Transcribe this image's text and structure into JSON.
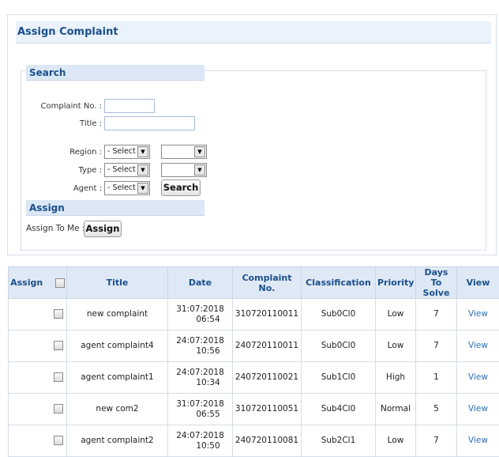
{
  "panel": {
    "title": "Assign Complaint"
  },
  "search": {
    "section_title": "Search",
    "complaint_no_label": "Complaint No. :",
    "complaint_no_value": "",
    "title_label": "Title :",
    "title_value": "",
    "region_label": "Region :",
    "region_selected": "- Select -",
    "region_sub_selected": "",
    "type_label": "Type :",
    "type_selected": "- Select -",
    "type_sub_selected": "",
    "agent_label": "Agent :",
    "agent_selected": "- Select -",
    "search_button": "Search"
  },
  "assign": {
    "section_title": "Assign",
    "assign_to_me_label": "Assign To Me :",
    "assign_button": "Assign"
  },
  "table": {
    "headers": [
      "Assign",
      "Title",
      "Date",
      "Complaint No.",
      "Classification",
      "Priority",
      "Days To Solve",
      "View"
    ],
    "rows": [
      {
        "title": "new complaint",
        "date": "31:07:2018",
        "time": "06:54",
        "complaint_no": "310720110011",
        "classification": "Sub0Cl0",
        "priority": "Low",
        "days": "7",
        "view": "View"
      },
      {
        "title": "agent complaint4",
        "date": "24:07:2018",
        "time": "10:56",
        "complaint_no": "240720110011",
        "classification": "Sub0Cl0",
        "priority": "Low",
        "days": "7",
        "view": "View"
      },
      {
        "title": "agent complaint1",
        "date": "24:07:2018",
        "time": "10:34",
        "complaint_no": "240720110021",
        "classification": "Sub1Cl0",
        "priority": "High",
        "days": "1",
        "view": "View"
      },
      {
        "title": "new com2",
        "date": "31:07:2018",
        "time": "06:55",
        "complaint_no": "310720110051",
        "classification": "Sub4Cl0",
        "priority": "Normal",
        "days": "5",
        "view": "View"
      },
      {
        "title": "agent complaint2",
        "date": "24:07:2018",
        "time": "10:50",
        "complaint_no": "240720110081",
        "classification": "Sub2Cl1",
        "priority": "Low",
        "days": "7",
        "view": "View"
      }
    ]
  },
  "icons": {
    "select_arrow": "chevron-down-icon",
    "checkbox": "checkbox-icon"
  }
}
